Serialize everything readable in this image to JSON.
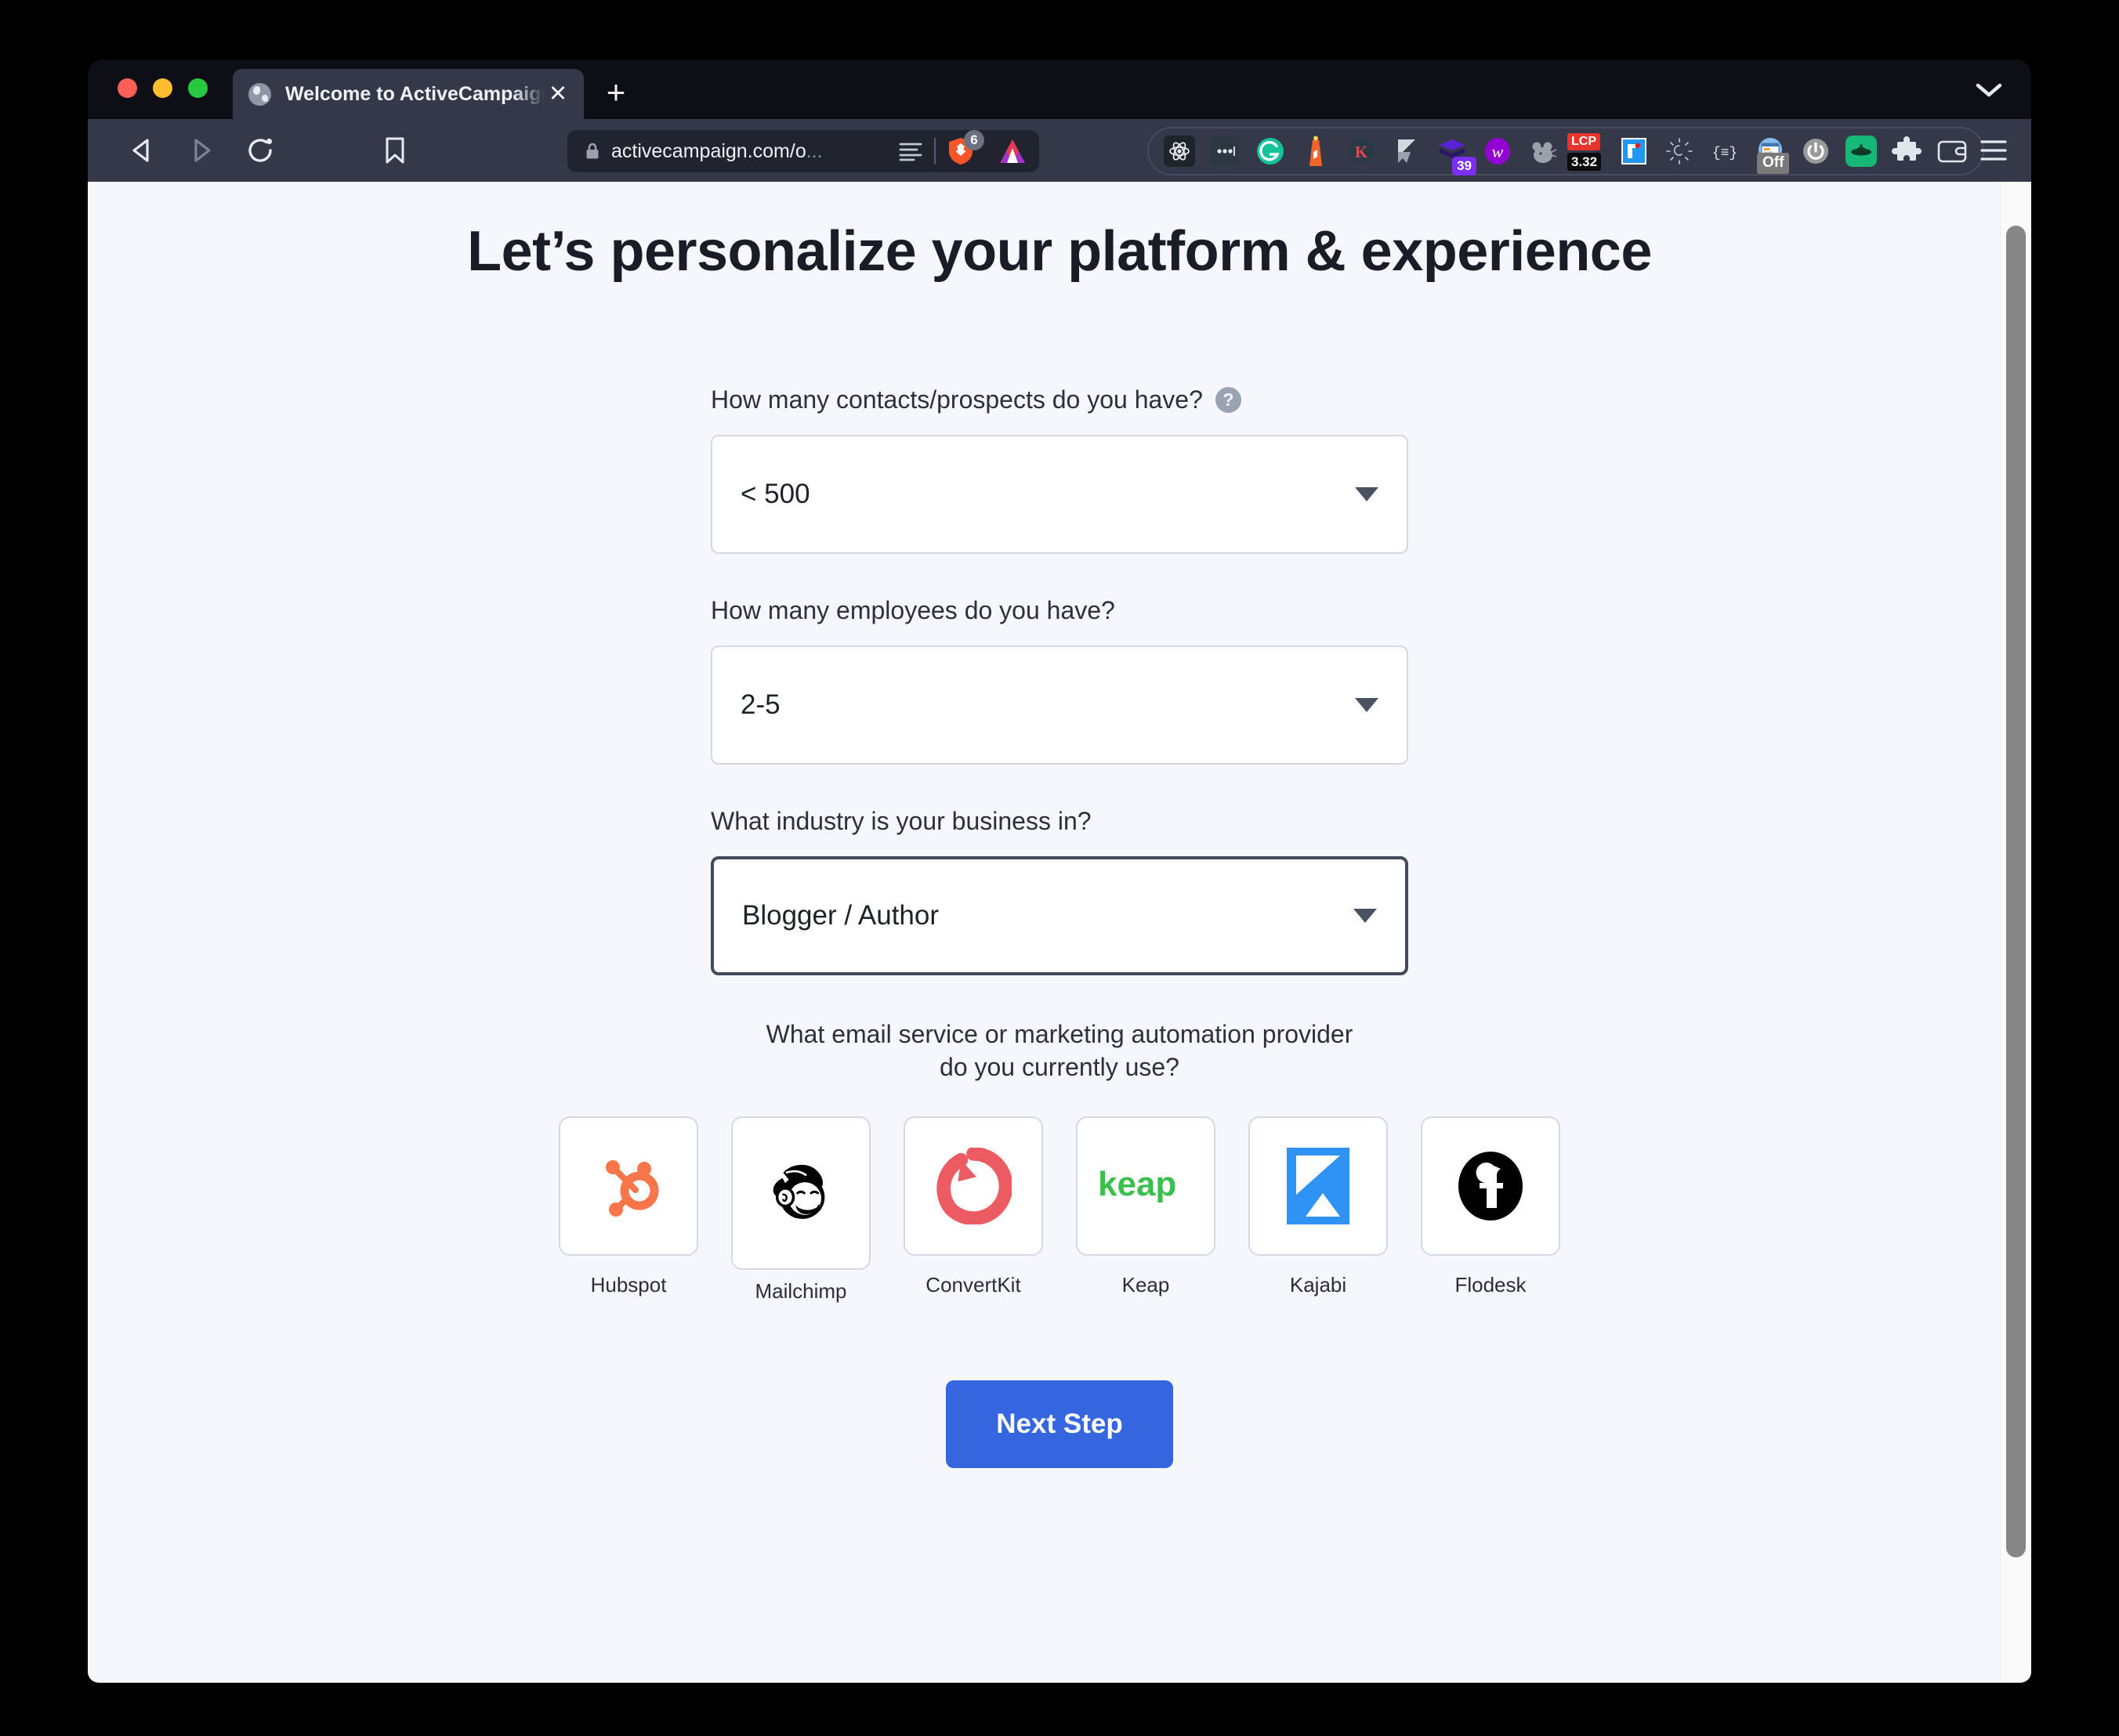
{
  "browser": {
    "name": "brave-browser",
    "traffic_lights": [
      "close",
      "minimize",
      "maximize"
    ],
    "tab": {
      "title": "Welcome to ActiveCampaign - T",
      "favicon": "globe-icon",
      "close_label": "✕"
    },
    "new_tab_label": "+",
    "toolbar": {
      "back": "back-icon",
      "forward": "forward-icon",
      "reload": "reload-icon",
      "bookmark": "bookmark-icon"
    },
    "url_bar": {
      "secure": true,
      "url_visible": "activecampaign.com/o",
      "url_truncated": "...",
      "reader_icon": "reader-mode-icon",
      "shield_count": "6"
    },
    "extensions": [
      {
        "name": "react-devtools-icon",
        "label": ""
      },
      {
        "name": "dots-menu-icon",
        "label": ""
      },
      {
        "name": "grammarly-icon",
        "label": ""
      },
      {
        "name": "lighthouse-icon",
        "label": ""
      },
      {
        "name": "kit-k-icon",
        "label": ""
      },
      {
        "name": "bookmark-arrow-icon",
        "label": ""
      },
      {
        "name": "notion-web-clipper-icon",
        "label": "39"
      },
      {
        "name": "wistia-icon",
        "label": ""
      },
      {
        "name": "grey-mouse-icon",
        "label": ""
      },
      {
        "name": "lcp-badge-icon",
        "label": "LCP",
        "value": "3.32"
      },
      {
        "name": "blue-form-icon",
        "label": ""
      },
      {
        "name": "sun-rays-icon",
        "label": ""
      },
      {
        "name": "json-viewer-icon",
        "label": "{≡}"
      },
      {
        "name": "window-resizer-icon",
        "label": "Off"
      },
      {
        "name": "power-toggle-icon",
        "label": ""
      },
      {
        "name": "green-ufo-icon",
        "label": ""
      },
      {
        "name": "extensions-puzzle-icon",
        "label": ""
      },
      {
        "name": "brave-wallet-icon",
        "label": ""
      }
    ],
    "menu_icon": "hamburger-menu-icon",
    "window_chevron": "chevron-down-icon"
  },
  "page": {
    "title": "Let’s personalize your platform & experience",
    "fields": [
      {
        "label": "How many contacts/prospects do you have?",
        "has_help": true,
        "help_glyph": "?",
        "value": "< 500",
        "focused": false
      },
      {
        "label": "How many employees do you have?",
        "has_help": false,
        "value": "2-5",
        "focused": false
      },
      {
        "label": "What industry is your business in?",
        "has_help": false,
        "value": "Blogger / Author",
        "focused": true
      }
    ],
    "esp_question_line1": "What email service or marketing automation provider",
    "esp_question_line2": "do you currently use?",
    "providers": [
      {
        "label": "Hubspot",
        "icon": "hubspot-logo-icon",
        "offset": false
      },
      {
        "label": "Mailchimp",
        "icon": "mailchimp-logo-icon",
        "offset": true
      },
      {
        "label": "ConvertKit",
        "icon": "convertkit-logo-icon",
        "offset": false
      },
      {
        "label": "Keap",
        "icon": "keap-logo-icon",
        "offset": false
      },
      {
        "label": "Kajabi",
        "icon": "kajabi-logo-icon",
        "offset": false
      },
      {
        "label": "Flodesk",
        "icon": "flodesk-logo-icon",
        "offset": false
      }
    ],
    "next_button": "Next Step",
    "colors": {
      "page_bg": "#f6f7fd",
      "primary_button": "#3566e0",
      "heading": "#1b1d26",
      "field_border": "#d3d8e3",
      "field_border_focused": "#434a5c",
      "hubspot": "#f8764a",
      "convertkit": "#ec5b62",
      "keap": "#3bbf4c",
      "kajabi": "#2f93f5",
      "flodesk": "#000000"
    }
  }
}
